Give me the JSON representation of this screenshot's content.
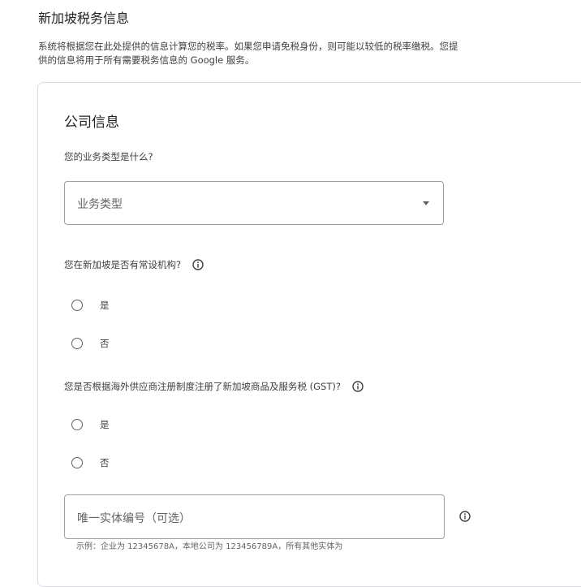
{
  "page": {
    "title": "新加坡税务信息",
    "intro": "系统将根据您在此处提供的信息计算您的税率。如果您申请免税身份，则可能以较低的税率缴税。您提供的信息将用于所有需要税务信息的 Google 服务。"
  },
  "company": {
    "section_title": "公司信息",
    "business_type": {
      "question": "您的业务类型是什么?",
      "placeholder": "业务类型"
    },
    "permanent_establishment": {
      "question": "您在新加坡是否有常设机构?",
      "options": [
        "是",
        "否"
      ]
    },
    "gst_registration": {
      "question": "您是否根据海外供应商注册制度注册了新加坡商品及服务税 (GST)?",
      "options": [
        "是",
        "否"
      ]
    },
    "uen": {
      "placeholder": "唯一实体编号（可选）",
      "helper": "示例：企业为 12345678A，本地公司为 123456789A，所有其他实体为"
    }
  },
  "icons": {
    "info": "info-icon",
    "dropdown": "chevron-down-icon"
  },
  "colors": {
    "border": "#dadce0",
    "input_border": "#9aa0a6",
    "text": "#202124",
    "muted": "#5f6368"
  }
}
